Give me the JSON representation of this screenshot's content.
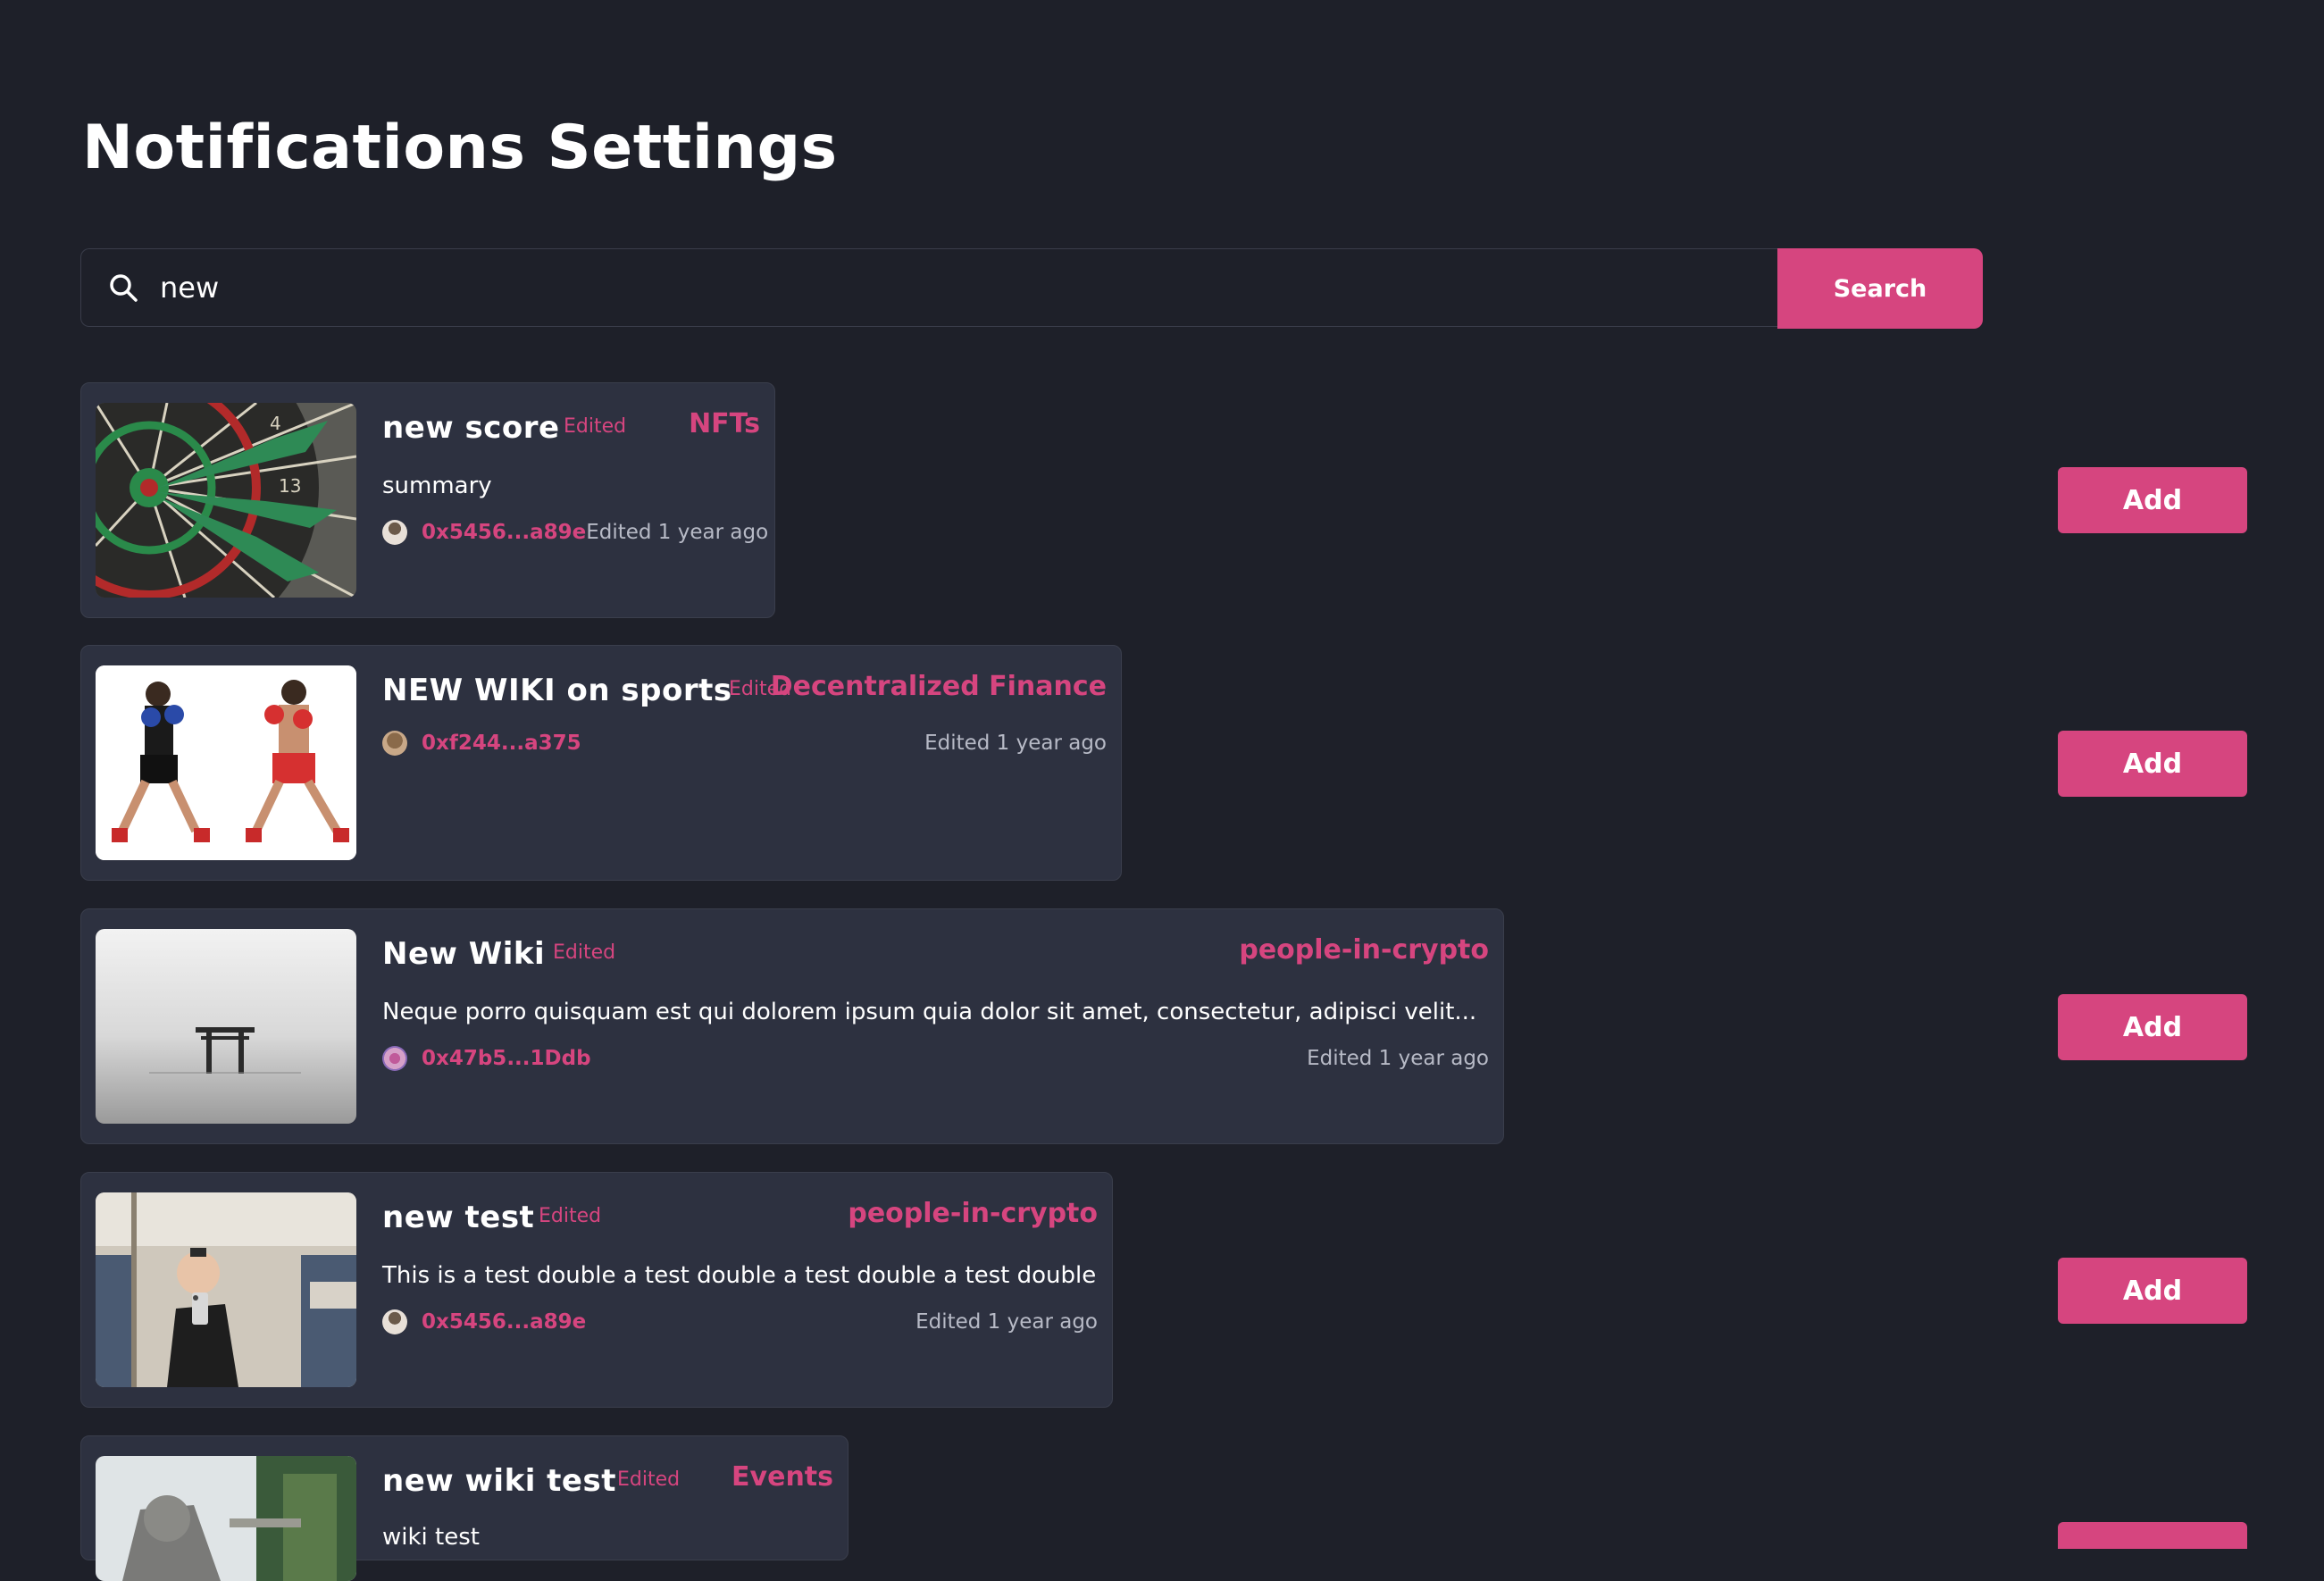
{
  "page": {
    "title": "Notifications Settings"
  },
  "search": {
    "value": "new",
    "button_label": "Search"
  },
  "colors": {
    "background": "#1e2029",
    "card": "#2d3140",
    "accent": "#d6457f",
    "muted_text": "#b7bac6"
  },
  "wikis": [
    {
      "title": "new score",
      "edited_tag": "Edited",
      "category": "NFTs",
      "summary": "summary",
      "address": "0x5456...a89e",
      "edited_time": "Edited 1 year ago",
      "add_label": "Add",
      "image": "dartboard-image"
    },
    {
      "title": "NEW WIKI on sports",
      "edited_tag": "Edited",
      "category": "Decentralized Finance",
      "summary": "",
      "address": "0xf244...a375",
      "edited_time": "Edited 1 year ago",
      "add_label": "Add",
      "image": "boxers-image"
    },
    {
      "title": "New Wiki",
      "edited_tag": "Edited",
      "category": "people-in-crypto",
      "summary": "Neque porro quisquam est qui dolorem ipsum quia dolor sit amet, consectetur, adipisci velit...",
      "address": "0x47b5...1Ddb",
      "edited_time": "Edited 1 year ago",
      "add_label": "Add",
      "image": "torii-gate-image"
    },
    {
      "title": "new test",
      "edited_tag": "Edited",
      "category": "people-in-crypto",
      "summary": "This is a test double a test double a test double a test double",
      "address": "0x5456...a89e",
      "edited_time": "Edited 1 year ago",
      "add_label": "Add",
      "image": "child-selfie-image"
    },
    {
      "title": "new wiki test",
      "edited_tag": "Edited",
      "category": "Events",
      "summary": "wiki test",
      "address": "",
      "edited_time": "",
      "add_label": "",
      "image": "stone-statue-image"
    }
  ]
}
